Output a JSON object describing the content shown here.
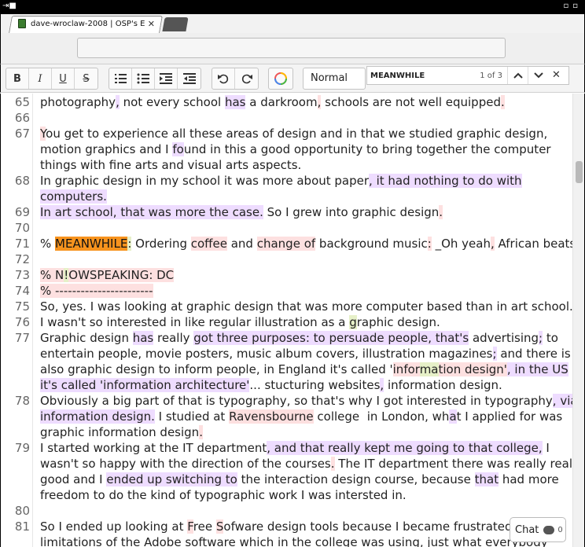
{
  "titlebar": {
    "left_glyph": "⇥■",
    "right_glyph": "▫▫"
  },
  "tab": {
    "title": "dave-wroclaw-2008 | OSP's E",
    "close": "✕"
  },
  "toolbar": {
    "bold": "B",
    "italic": "I",
    "underline": "U",
    "strike": "S",
    "style_value": "Normal"
  },
  "find": {
    "query": "MEANWHILE",
    "count": "1 of 3",
    "prev": "⌃",
    "next": "⌄",
    "close": "✕"
  },
  "editor": {
    "lines": [
      {
        "n": "65",
        "segs": [
          {
            "t": "photography"
          },
          {
            "t": ",",
            "h": "p"
          },
          {
            "t": " not every school "
          },
          {
            "t": "has",
            "h": "p"
          },
          {
            "t": " a darkroom"
          },
          {
            "t": ",",
            "h": "r"
          },
          {
            "t": " schools are not well equipped"
          },
          {
            "t": ".",
            "h": "r"
          }
        ]
      },
      {
        "n": "66",
        "segs": []
      },
      {
        "n": "67",
        "segs": [
          {
            "t": "Y",
            "h": "r"
          },
          {
            "t": "ou get to experience all these areas of design and in that we studied graphic design,"
          }
        ]
      },
      {
        "n": "",
        "segs": [
          {
            "t": "motion graphics and I "
          },
          {
            "t": "fo",
            "h": "p"
          },
          {
            "t": "und in this a good opportunity to bring together the computer"
          }
        ]
      },
      {
        "n": "",
        "segs": [
          {
            "t": "things with fine arts and visual arts aspects."
          }
        ]
      },
      {
        "n": "68",
        "segs": [
          {
            "t": "In graphic design in my school it was more about paper"
          },
          {
            "t": ", it had nothing to do with",
            "h": "p"
          }
        ]
      },
      {
        "n": "",
        "segs": [
          {
            "t": "computers.",
            "h": "p"
          }
        ]
      },
      {
        "n": "69",
        "segs": [
          {
            "t": "In art school, that was more the case.",
            "h": "p"
          },
          {
            "t": " So I grew into graphic design"
          },
          {
            "t": ".",
            "h": "r"
          }
        ]
      },
      {
        "n": "70",
        "segs": []
      },
      {
        "n": "71",
        "segs": [
          {
            "t": "% "
          },
          {
            "t": "MEANWHILE",
            "h": "o"
          },
          {
            "t": ":",
            "h": "g"
          },
          {
            "t": " Ordering "
          },
          {
            "t": "coffee",
            "h": "r"
          },
          {
            "t": " and "
          },
          {
            "t": "change of",
            "h": "r"
          },
          {
            "t": " background music"
          },
          {
            "t": ":",
            "h": "r"
          },
          {
            "t": " _Oh yeah"
          },
          {
            "t": ",",
            "h": "r"
          },
          {
            "t": " African beats"
          },
          {
            "t": "!_",
            "h": "r"
          }
        ]
      },
      {
        "n": "72",
        "segs": []
      },
      {
        "n": "73",
        "segs": [
          {
            "t": "% N",
            "h": "r"
          },
          {
            "t": "!",
            "h": "g"
          },
          {
            "t": "OWSPEAKING: DC",
            "h": "r"
          }
        ]
      },
      {
        "n": "74",
        "segs": [
          {
            "t": "% -----------------------",
            "h": "r"
          }
        ]
      },
      {
        "n": "75",
        "segs": [
          {
            "t": "So, yes. I was looking at graphic design that was more computer based than in art school."
          }
        ]
      },
      {
        "n": "76",
        "segs": [
          {
            "t": "I wasn't so interested in like regular illustration as a "
          },
          {
            "t": "g",
            "h": "g"
          },
          {
            "t": "raphic design."
          }
        ]
      },
      {
        "n": "77",
        "segs": [
          {
            "t": "Graphic design "
          },
          {
            "t": "has",
            "h": "p"
          },
          {
            "t": " really "
          },
          {
            "t": "got three purposes: to persuade people, that's",
            "h": "p"
          },
          {
            "t": " advertising"
          },
          {
            "t": ";",
            "h": "p"
          },
          {
            "t": " to"
          }
        ]
      },
      {
        "n": "",
        "segs": [
          {
            "t": "entertain people, movie posters, music album covers, illustration magazines"
          },
          {
            "t": ";",
            "h": "p"
          },
          {
            "t": " and there is"
          }
        ]
      },
      {
        "n": "",
        "segs": [
          {
            "t": "also graphic design to inform people, in England it's called '"
          },
          {
            "t": "infor",
            "h": "r"
          },
          {
            "t": "ma",
            "h": "g"
          },
          {
            "t": "tion design'",
            "h": "r"
          },
          {
            "t": ", in the US",
            "h": "p"
          }
        ]
      },
      {
        "n": "",
        "segs": [
          {
            "t": "it's called 'information architecture'",
            "h": "p"
          },
          {
            "t": "..."
          },
          {
            "t": " stucturing websites"
          },
          {
            "t": ",",
            "h": "p"
          },
          {
            "t": " information design."
          }
        ]
      },
      {
        "n": "78",
        "segs": [
          {
            "t": "Obviously a big part of that is typography, so that's why I got interested in typography"
          },
          {
            "t": ", via",
            "h": "p"
          }
        ]
      },
      {
        "n": "",
        "segs": [
          {
            "t": "information design.",
            "h": "p"
          },
          {
            "t": " I studied at "
          },
          {
            "t": "Ravensbourne",
            "h": "r"
          },
          {
            "t": " college  in London, wh"
          },
          {
            "t": "a",
            "h": "p"
          },
          {
            "t": "t I applied for was"
          }
        ]
      },
      {
        "n": "",
        "segs": [
          {
            "t": "graphic information design"
          },
          {
            "t": ".",
            "h": "r"
          }
        ]
      },
      {
        "n": "79",
        "segs": [
          {
            "t": "I started working at the IT department"
          },
          {
            "t": ", and that really kept me going to that college,",
            "h": "p"
          },
          {
            "t": " I"
          }
        ]
      },
      {
        "n": "",
        "segs": [
          {
            "t": "wasn't so happy with the direction of the courses"
          },
          {
            "t": ".",
            "h": "r"
          },
          {
            "t": " The IT department there was really really"
          }
        ]
      },
      {
        "n": "",
        "segs": [
          {
            "t": "good and I "
          },
          {
            "t": "ended up switching to",
            "h": "p"
          },
          {
            "t": " the interaction design course, because "
          },
          {
            "t": "that",
            "h": "p"
          },
          {
            "t": " had more"
          }
        ]
      },
      {
        "n": "",
        "segs": [
          {
            "t": "freedom to do the kind of typographic work I was intersted in."
          }
        ]
      },
      {
        "n": "80",
        "segs": []
      },
      {
        "n": "81",
        "segs": [
          {
            "t": "So I ended up looking at "
          },
          {
            "t": "F",
            "h": "r"
          },
          {
            "t": "ree "
          },
          {
            "t": "S",
            "h": "r"
          },
          {
            "t": "ofware design tools because I became frustrated by"
          }
        ]
      },
      {
        "n": "",
        "segs": [
          {
            "t": "limitations of the Adobe software which in the college was using, just what everybody"
          }
        ]
      }
    ]
  },
  "chat": {
    "label": "Chat",
    "count": "0"
  }
}
